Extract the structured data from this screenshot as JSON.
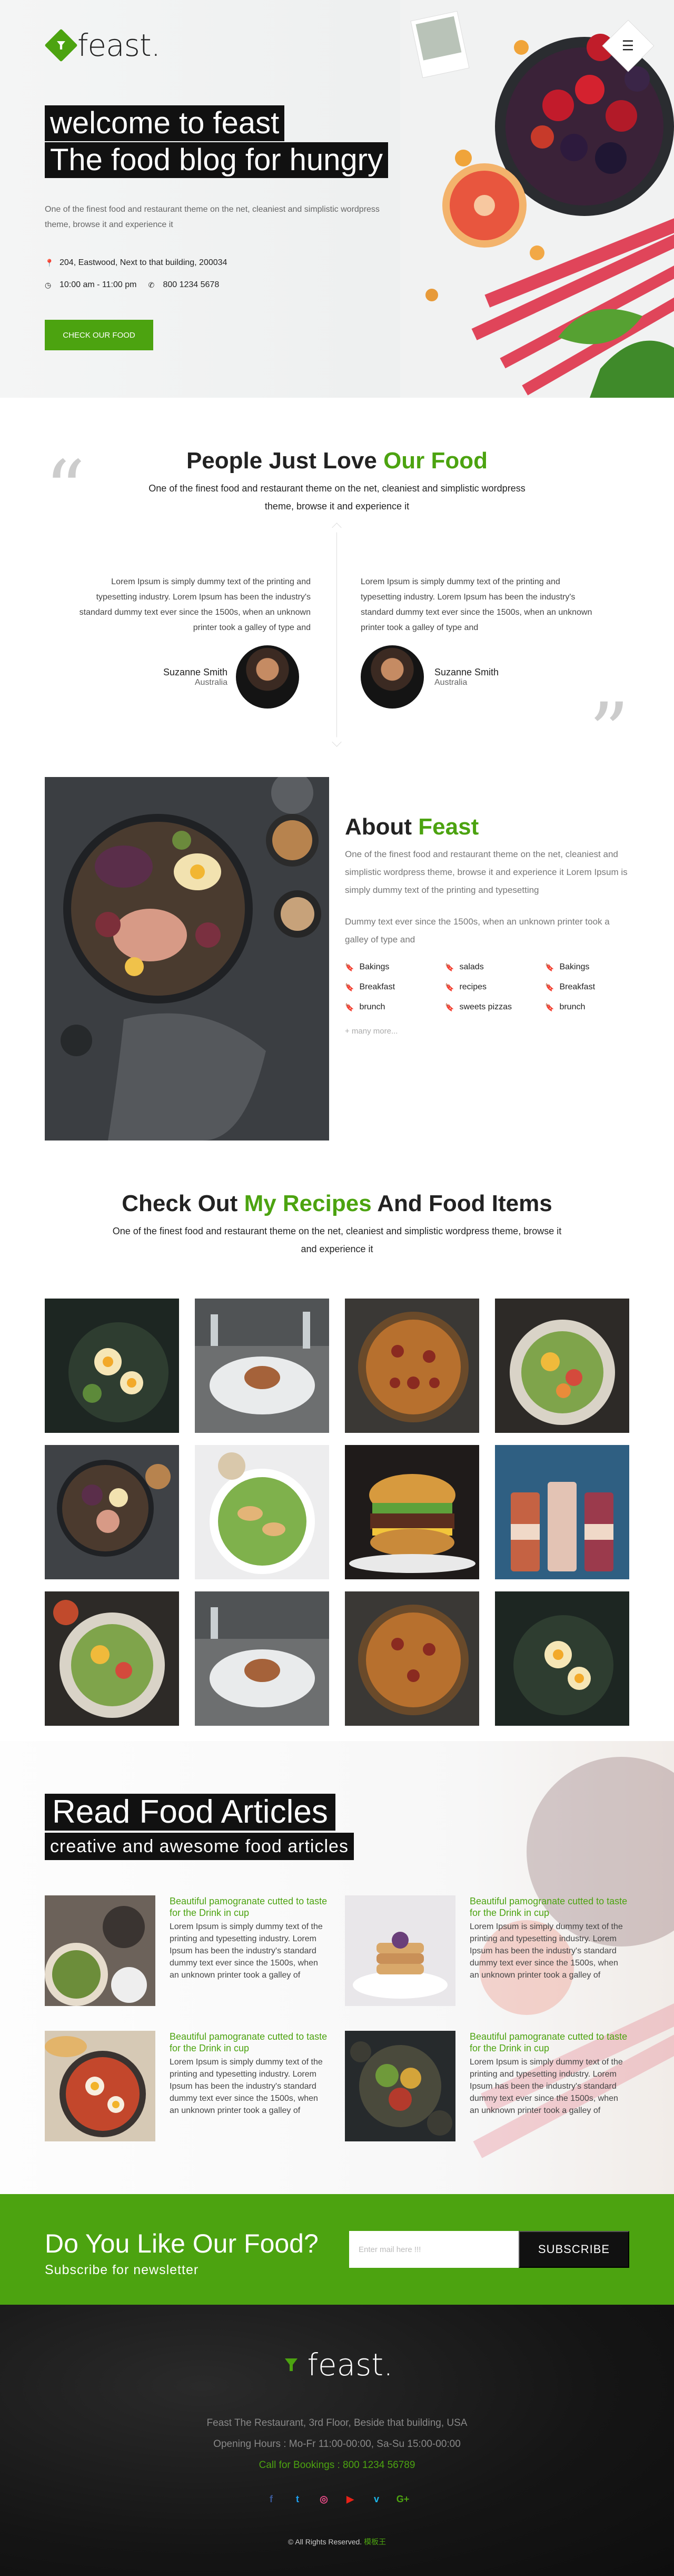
{
  "header": {
    "logo_text": "feast.",
    "menu_icon": "hamburger-icon"
  },
  "hero": {
    "title_line1": "welcome to feast",
    "title_line2": "The food blog for hungry",
    "description": "One of the finest food and restaurant theme on the net, cleaniest and simplistic wordpress theme, browse it and experience it",
    "address": "204, Eastwood, Next to that building, 200034",
    "hours": "10:00 am - 11:00 pm",
    "phone": "800 1234 5678",
    "cta": "Check our food"
  },
  "testimonials": {
    "title_plain": "People Just Love ",
    "title_accent": "Our Food",
    "subtitle": "One of the finest food and restaurant theme on the net, cleaniest and simplistic wordpress theme, browse it and experience it",
    "items": [
      {
        "text": "Lorem Ipsum is simply dummy text of the printing and typesetting industry. Lorem Ipsum has been the industry's standard dummy text ever since the 1500s, when an unknown printer took a galley of type and",
        "name": "Suzanne Smith",
        "location": "Australia"
      },
      {
        "text": "Lorem Ipsum is simply dummy text of the printing and typesetting industry. Lorem Ipsum has been the industry's standard dummy text ever since the 1500s, when an unknown printer took a galley of type and",
        "name": "Suzanne Smith",
        "location": "Australia"
      }
    ]
  },
  "about": {
    "title_plain": "About ",
    "title_accent": "Feast",
    "para1": "One of the finest food and restaurant theme on the net, cleaniest and simplistic wordpress theme, browse it and experience it Lorem Ipsum is simply dummy text of the printing and typesetting",
    "para2": "Dummy text ever since the 1500s, when an unknown printer took a galley of type and",
    "tags": [
      "Bakings",
      "salads",
      "Bakings",
      "Breakfast",
      "recipes",
      "Breakfast",
      "brunch",
      "sweets pizzas",
      "brunch"
    ],
    "more": "+ many more..."
  },
  "recipes": {
    "title_plain1": "Check Out ",
    "title_accent": "My Recipes",
    "title_plain2": " And Food Items",
    "subtitle": "One of the finest food and restaurant theme on the net, cleaniest and simplistic wordpress theme, browse it and experience it"
  },
  "articles": {
    "title": "Read Food Articles",
    "subtitle": "creative and awesome food articles",
    "items": [
      {
        "title": "Beautiful pamogranate cutted to taste for the Drink in cup",
        "text": "Lorem Ipsum is simply dummy text of the printing and typesetting industry. Lorem Ipsum has been the industry's standard dummy text ever since the 1500s, when an unknown printer took a galley of"
      },
      {
        "title": "Beautiful pamogranate cutted to taste for the Drink in cup",
        "text": "Lorem Ipsum is simply dummy text of the printing and typesetting industry. Lorem Ipsum has been the industry's standard dummy text ever since the 1500s, when an unknown printer took a galley of"
      },
      {
        "title": "Beautiful pamogranate cutted to taste for the Drink in cup",
        "text": "Lorem Ipsum is simply dummy text of the printing and typesetting industry. Lorem Ipsum has been the industry's standard dummy text ever since the 1500s, when an unknown printer took a galley of"
      },
      {
        "title": "Beautiful pamogranate cutted to taste for the Drink in cup",
        "text": "Lorem Ipsum is simply dummy text of the printing and typesetting industry. Lorem Ipsum has been the industry's standard dummy text ever since the 1500s, when an unknown printer took a galley of"
      }
    ]
  },
  "newsletter": {
    "title": "Do You Like Our Food?",
    "subtitle": "Subscribe for newsletter",
    "placeholder": "Enter mail here !!!",
    "button": "Subscribe"
  },
  "footer": {
    "logo_text": "feast.",
    "address": "Feast The Restaurant, 3rd Floor, Beside that building, USA",
    "hours": "Opening Hours : Mo-Fr 11:00-00:00, Sa-Su 15:00-00:00",
    "bookings": "Call for Bookings : 800 1234 56789",
    "socials": [
      "facebook-icon",
      "twitter-icon",
      "dribbble-icon",
      "youtube-icon",
      "vimeo-icon",
      "google-plus-icon"
    ],
    "copyright": "© All Rights Reserved.",
    "copyright_brand": "模板王"
  },
  "colors": {
    "accent": "#4ca310",
    "dark": "#111111",
    "footer": "#141414"
  }
}
